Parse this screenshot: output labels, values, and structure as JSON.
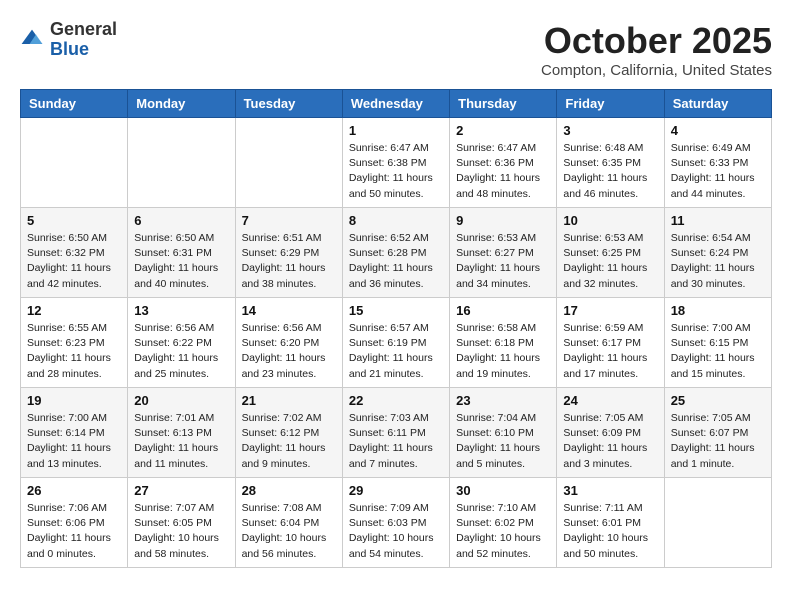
{
  "logo": {
    "general": "General",
    "blue": "Blue"
  },
  "title": "October 2025",
  "location": "Compton, California, United States",
  "days_of_week": [
    "Sunday",
    "Monday",
    "Tuesday",
    "Wednesday",
    "Thursday",
    "Friday",
    "Saturday"
  ],
  "weeks": [
    [
      {
        "day": "",
        "info": ""
      },
      {
        "day": "",
        "info": ""
      },
      {
        "day": "",
        "info": ""
      },
      {
        "day": "1",
        "info": "Sunrise: 6:47 AM\nSunset: 6:38 PM\nDaylight: 11 hours\nand 50 minutes."
      },
      {
        "day": "2",
        "info": "Sunrise: 6:47 AM\nSunset: 6:36 PM\nDaylight: 11 hours\nand 48 minutes."
      },
      {
        "day": "3",
        "info": "Sunrise: 6:48 AM\nSunset: 6:35 PM\nDaylight: 11 hours\nand 46 minutes."
      },
      {
        "day": "4",
        "info": "Sunrise: 6:49 AM\nSunset: 6:33 PM\nDaylight: 11 hours\nand 44 minutes."
      }
    ],
    [
      {
        "day": "5",
        "info": "Sunrise: 6:50 AM\nSunset: 6:32 PM\nDaylight: 11 hours\nand 42 minutes."
      },
      {
        "day": "6",
        "info": "Sunrise: 6:50 AM\nSunset: 6:31 PM\nDaylight: 11 hours\nand 40 minutes."
      },
      {
        "day": "7",
        "info": "Sunrise: 6:51 AM\nSunset: 6:29 PM\nDaylight: 11 hours\nand 38 minutes."
      },
      {
        "day": "8",
        "info": "Sunrise: 6:52 AM\nSunset: 6:28 PM\nDaylight: 11 hours\nand 36 minutes."
      },
      {
        "day": "9",
        "info": "Sunrise: 6:53 AM\nSunset: 6:27 PM\nDaylight: 11 hours\nand 34 minutes."
      },
      {
        "day": "10",
        "info": "Sunrise: 6:53 AM\nSunset: 6:25 PM\nDaylight: 11 hours\nand 32 minutes."
      },
      {
        "day": "11",
        "info": "Sunrise: 6:54 AM\nSunset: 6:24 PM\nDaylight: 11 hours\nand 30 minutes."
      }
    ],
    [
      {
        "day": "12",
        "info": "Sunrise: 6:55 AM\nSunset: 6:23 PM\nDaylight: 11 hours\nand 28 minutes."
      },
      {
        "day": "13",
        "info": "Sunrise: 6:56 AM\nSunset: 6:22 PM\nDaylight: 11 hours\nand 25 minutes."
      },
      {
        "day": "14",
        "info": "Sunrise: 6:56 AM\nSunset: 6:20 PM\nDaylight: 11 hours\nand 23 minutes."
      },
      {
        "day": "15",
        "info": "Sunrise: 6:57 AM\nSunset: 6:19 PM\nDaylight: 11 hours\nand 21 minutes."
      },
      {
        "day": "16",
        "info": "Sunrise: 6:58 AM\nSunset: 6:18 PM\nDaylight: 11 hours\nand 19 minutes."
      },
      {
        "day": "17",
        "info": "Sunrise: 6:59 AM\nSunset: 6:17 PM\nDaylight: 11 hours\nand 17 minutes."
      },
      {
        "day": "18",
        "info": "Sunrise: 7:00 AM\nSunset: 6:15 PM\nDaylight: 11 hours\nand 15 minutes."
      }
    ],
    [
      {
        "day": "19",
        "info": "Sunrise: 7:00 AM\nSunset: 6:14 PM\nDaylight: 11 hours\nand 13 minutes."
      },
      {
        "day": "20",
        "info": "Sunrise: 7:01 AM\nSunset: 6:13 PM\nDaylight: 11 hours\nand 11 minutes."
      },
      {
        "day": "21",
        "info": "Sunrise: 7:02 AM\nSunset: 6:12 PM\nDaylight: 11 hours\nand 9 minutes."
      },
      {
        "day": "22",
        "info": "Sunrise: 7:03 AM\nSunset: 6:11 PM\nDaylight: 11 hours\nand 7 minutes."
      },
      {
        "day": "23",
        "info": "Sunrise: 7:04 AM\nSunset: 6:10 PM\nDaylight: 11 hours\nand 5 minutes."
      },
      {
        "day": "24",
        "info": "Sunrise: 7:05 AM\nSunset: 6:09 PM\nDaylight: 11 hours\nand 3 minutes."
      },
      {
        "day": "25",
        "info": "Sunrise: 7:05 AM\nSunset: 6:07 PM\nDaylight: 11 hours\nand 1 minute."
      }
    ],
    [
      {
        "day": "26",
        "info": "Sunrise: 7:06 AM\nSunset: 6:06 PM\nDaylight: 11 hours\nand 0 minutes."
      },
      {
        "day": "27",
        "info": "Sunrise: 7:07 AM\nSunset: 6:05 PM\nDaylight: 10 hours\nand 58 minutes."
      },
      {
        "day": "28",
        "info": "Sunrise: 7:08 AM\nSunset: 6:04 PM\nDaylight: 10 hours\nand 56 minutes."
      },
      {
        "day": "29",
        "info": "Sunrise: 7:09 AM\nSunset: 6:03 PM\nDaylight: 10 hours\nand 54 minutes."
      },
      {
        "day": "30",
        "info": "Sunrise: 7:10 AM\nSunset: 6:02 PM\nDaylight: 10 hours\nand 52 minutes."
      },
      {
        "day": "31",
        "info": "Sunrise: 7:11 AM\nSunset: 6:01 PM\nDaylight: 10 hours\nand 50 minutes."
      },
      {
        "day": "",
        "info": ""
      }
    ]
  ]
}
